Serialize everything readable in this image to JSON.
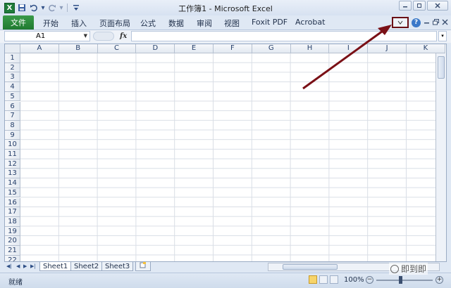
{
  "window": {
    "title": "工作簿1 - Microsoft Excel",
    "app_icon": "X"
  },
  "quick_access": {
    "save": "save-icon",
    "undo": "undo-icon",
    "redo": "redo-icon",
    "customize": "customize-icon"
  },
  "ribbon": {
    "file_tab": "文件",
    "tabs": [
      "开始",
      "插入",
      "页面布局",
      "公式",
      "数据",
      "审阅",
      "视图",
      "Foxit PDF",
      "Acrobat"
    ]
  },
  "formula_bar": {
    "name_box": "A1",
    "fx": "fx",
    "formula": ""
  },
  "grid": {
    "columns": [
      "A",
      "B",
      "C",
      "D",
      "E",
      "F",
      "G",
      "H",
      "I",
      "J",
      "K"
    ],
    "rows": [
      "1",
      "2",
      "3",
      "4",
      "5",
      "6",
      "7",
      "8",
      "9",
      "10",
      "11",
      "12",
      "13",
      "14",
      "15",
      "16",
      "17",
      "18",
      "19",
      "20",
      "21",
      "22"
    ]
  },
  "sheets": {
    "tabs": [
      "Sheet1",
      "Sheet2",
      "Sheet3"
    ],
    "active": "Sheet1"
  },
  "status": {
    "ready": "就绪",
    "zoom": "100%",
    "zoom_minus": "−",
    "zoom_plus": "+"
  },
  "watermark": {
    "text": "即到即"
  },
  "colors": {
    "annotation_arrow": "#7a1016",
    "file_tab": "#1f7a30"
  }
}
